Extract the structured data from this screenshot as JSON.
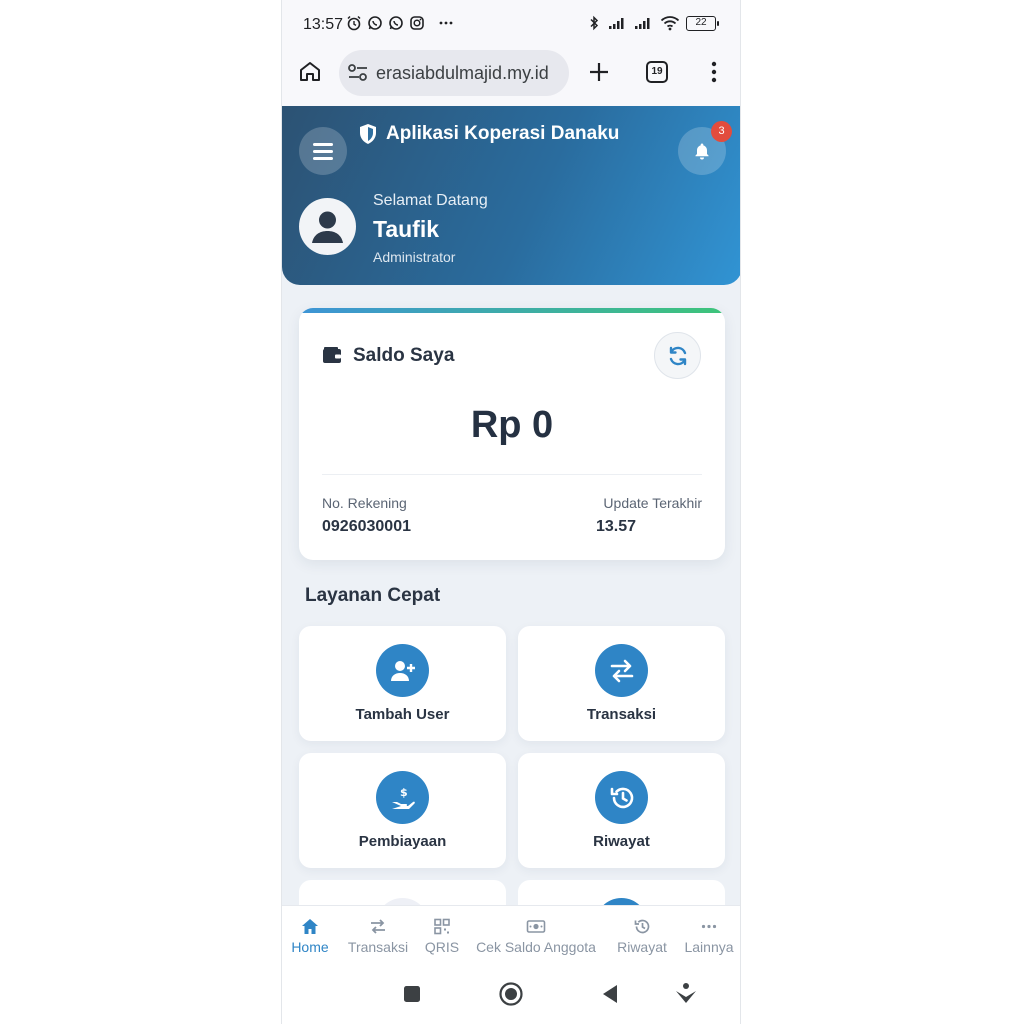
{
  "status_bar": {
    "time": "13:57",
    "battery": "22"
  },
  "browser": {
    "url": "erasiabdulmajid.my.id",
    "tab_count": "19"
  },
  "header": {
    "app_title": "Aplikasi Koperasi Danaku",
    "notification_count": "3",
    "welcome_text": "Selamat Datang",
    "user_name": "Taufik",
    "user_role": "Administrator"
  },
  "balance": {
    "title": "Saldo Saya",
    "amount": "Rp 0",
    "account_label": "No. Rekening",
    "account_number": "0926030001",
    "updated_label": "Update Terakhir",
    "updated_value": "13.57"
  },
  "quick_services": {
    "title": "Layanan Cepat",
    "items": [
      {
        "label": "Tambah User",
        "icon": "user-plus-icon"
      },
      {
        "label": "Transaksi",
        "icon": "exchange-icon"
      },
      {
        "label": "Pembiayaan",
        "icon": "hand-dollar-icon"
      },
      {
        "label": "Riwayat",
        "icon": "history-icon"
      }
    ]
  },
  "bottom_nav": {
    "items": [
      {
        "label": "Home",
        "icon": "home-icon",
        "active": true
      },
      {
        "label": "Transaksi",
        "icon": "exchange-icon"
      },
      {
        "label": "QRIS",
        "icon": "qr-icon"
      },
      {
        "label": "Cek Saldo Anggota",
        "icon": "money-icon"
      },
      {
        "label": "Riwayat",
        "icon": "history-icon"
      },
      {
        "label": "Lainnya",
        "icon": "more-icon"
      }
    ]
  },
  "colors": {
    "primary": "#2f85c6",
    "header_start": "#2c5273",
    "header_end": "#3194d4",
    "badge": "#e24c3d",
    "accent_green": "#3ec47a"
  }
}
